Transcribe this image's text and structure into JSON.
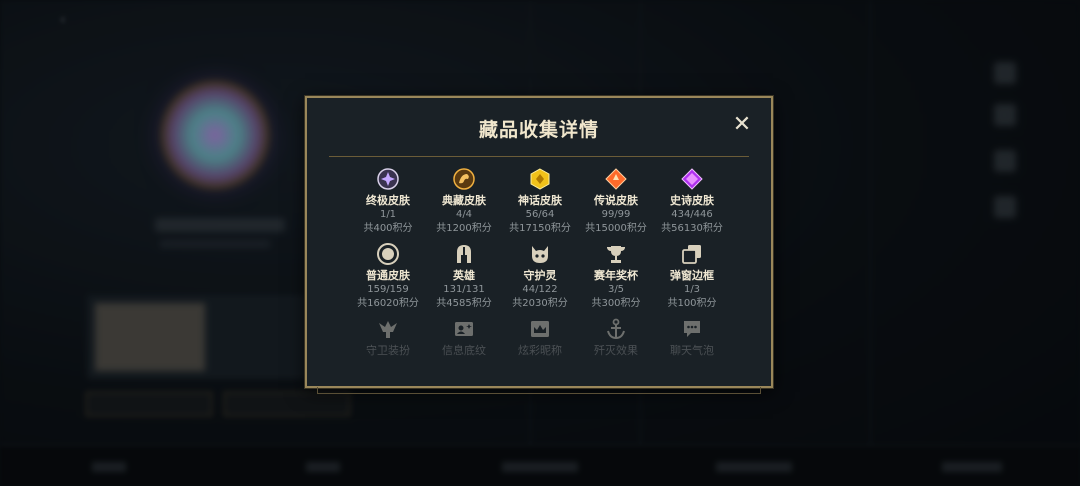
{
  "modal": {
    "title": "藏品收集详情",
    "close_glyph": "✕"
  },
  "categories": [
    {
      "label": "终极皮肤",
      "count": "1/1",
      "points": "共400积分",
      "icon": "ultimate-skin-icon",
      "color": "#b89cff"
    },
    {
      "label": "典藏皮肤",
      "count": "4/4",
      "points": "共1200积分",
      "icon": "collection-skin-icon",
      "color": "#e0a030"
    },
    {
      "label": "神话皮肤",
      "count": "56/64",
      "points": "共17150积分",
      "icon": "mythic-skin-icon",
      "color": "#f2c21a"
    },
    {
      "label": "传说皮肤",
      "count": "99/99",
      "points": "共15000积分",
      "icon": "legendary-skin-icon",
      "color": "#ff6a2a"
    },
    {
      "label": "史诗皮肤",
      "count": "434/446",
      "points": "共56130积分",
      "icon": "epic-skin-icon",
      "color": "#c040ff"
    },
    {
      "label": "普通皮肤",
      "count": "159/159",
      "points": "共16020积分",
      "icon": "normal-skin-icon",
      "color": "#d8d0bc"
    },
    {
      "label": "英雄",
      "count": "131/131",
      "points": "共4585积分",
      "icon": "hero-icon",
      "color": "#d8d0bc"
    },
    {
      "label": "守护灵",
      "count": "44/122",
      "points": "共2030积分",
      "icon": "guardian-icon",
      "color": "#d8d0bc"
    },
    {
      "label": "赛年奖杯",
      "count": "3/5",
      "points": "共300积分",
      "icon": "trophy-icon",
      "color": "#d8d0bc"
    },
    {
      "label": "弹窗边框",
      "count": "1/3",
      "points": "共100积分",
      "icon": "popup-frame-icon",
      "color": "#d8d0bc"
    },
    {
      "label": "守卫装扮",
      "icon": "ward-skin-icon",
      "color": "#9a9a94"
    },
    {
      "label": "信息底纹",
      "icon": "info-card-icon",
      "color": "#9a9a94"
    },
    {
      "label": "炫彩昵称",
      "icon": "name-color-icon",
      "color": "#9a9a94"
    },
    {
      "label": "歼灭效果",
      "icon": "ace-effect-icon",
      "color": "#9a9a94"
    },
    {
      "label": "聊天气泡",
      "icon": "chat-bubble-icon",
      "color": "#9a9a94"
    }
  ],
  "colors": {
    "accent_gold": "#9a875a",
    "panel_bg": "#1a2126"
  }
}
